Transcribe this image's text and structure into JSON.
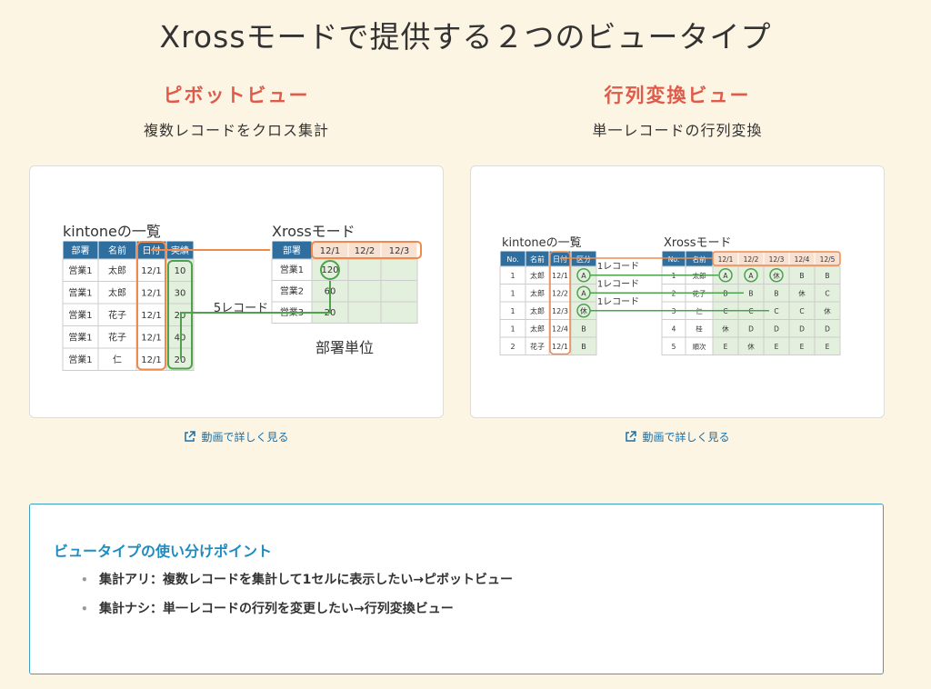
{
  "page": {
    "title": "Xrossモードで提供する２つのビュータイプ"
  },
  "colors": {
    "accent_red": "#e05a4a",
    "table_header": "#2f6f9f",
    "orange": "#f08a4b",
    "green": "#4ea24e",
    "link": "#1d6fa5",
    "points_title": "#1e8cc0"
  },
  "left": {
    "title": "ピボットビュー",
    "subtitle": "複数レコードをクロス集計",
    "link": "動画で詳しく見る",
    "link_icon": "external-link-icon",
    "diagram": {
      "list_title": "kintoneの一覧",
      "list_headers": [
        "部署",
        "名前",
        "日付",
        "実績"
      ],
      "list_rows": [
        [
          "営業1",
          "太郎",
          "12/1",
          "10"
        ],
        [
          "営業1",
          "太郎",
          "12/1",
          "30"
        ],
        [
          "営業1",
          "花子",
          "12/1",
          "20"
        ],
        [
          "営業1",
          "花子",
          "12/1",
          "40"
        ],
        [
          "営業1",
          "仁",
          "12/1",
          "20"
        ]
      ],
      "xross_title": "Xrossモード",
      "xross_headers": [
        "部署",
        "12/1",
        "12/2",
        "12/3"
      ],
      "xross_rows": [
        [
          "営業1",
          "120",
          "",
          ""
        ],
        [
          "営業2",
          "60",
          "",
          ""
        ],
        [
          "営業3",
          "20",
          "",
          ""
        ]
      ],
      "arrow_label": "5レコード",
      "unit_label": "部署単位"
    }
  },
  "right": {
    "title": "行列変換ビュー",
    "subtitle": "単一レコードの行列変換",
    "link": "動画で詳しく見る",
    "link_icon": "external-link-icon",
    "diagram": {
      "list_title": "kintoneの一覧",
      "list_headers": [
        "No.",
        "名前",
        "日付",
        "区分"
      ],
      "list_rows": [
        [
          "1",
          "太郎",
          "12/1",
          "A"
        ],
        [
          "1",
          "太郎",
          "12/2",
          "A"
        ],
        [
          "1",
          "太郎",
          "12/3",
          "休"
        ],
        [
          "1",
          "太郎",
          "12/4",
          "B"
        ],
        [
          "2",
          "花子",
          "12/1",
          "B"
        ]
      ],
      "record_labels": [
        "1レコード",
        "1レコード",
        "1レコード"
      ],
      "xross_title": "Xrossモード",
      "xross_headers": [
        "No.",
        "名前",
        "12/1",
        "12/2",
        "12/3",
        "12/4",
        "12/5"
      ],
      "xross_rows": [
        [
          "1",
          "太郎",
          "A",
          "A",
          "休",
          "B",
          "B"
        ],
        [
          "2",
          "花子",
          "B",
          "B",
          "B",
          "休",
          "C"
        ],
        [
          "3",
          "仁",
          "C",
          "C",
          "C",
          "C",
          "休"
        ],
        [
          "4",
          "桂",
          "休",
          "D",
          "D",
          "D",
          "D"
        ],
        [
          "5",
          "順次",
          "E",
          "休",
          "E",
          "E",
          "E"
        ]
      ]
    }
  },
  "points": {
    "title": "ビュータイプの使い分けポイント",
    "items": [
      "集計アリ：複数レコードを集計して1セルに表示したい→ピボットビュー",
      "集計ナシ：単一レコードの行列を変更したい→行列変換ビュー"
    ]
  }
}
